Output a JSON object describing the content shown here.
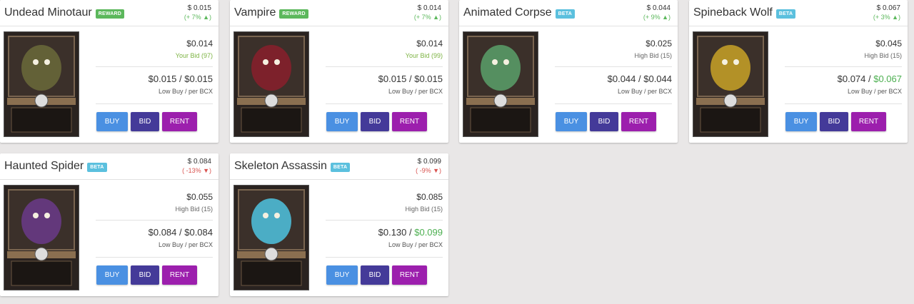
{
  "cards": [
    {
      "name": "Undead Minotaur",
      "tag": "REWARD",
      "tag_type": "reward",
      "price": "$ 0.015",
      "change": "(+ 7% ▲)",
      "change_dir": "up",
      "bid": "$0.014",
      "bid_label": "Your Bid (97)",
      "bid_label_type": "yours",
      "low_buy": "$0.015",
      "per_bcx": "$0.015",
      "per_bcx_green": false,
      "low_label": "Low Buy / per BCX",
      "art_color": "#6b6a3a"
    },
    {
      "name": "Vampire",
      "tag": "REWARD",
      "tag_type": "reward",
      "price": "$ 0.014",
      "change": "(+ 7% ▲)",
      "change_dir": "up",
      "bid": "$0.014",
      "bid_label": "Your Bid (99)",
      "bid_label_type": "yours",
      "low_buy": "$0.015",
      "per_bcx": "$0.015",
      "per_bcx_green": false,
      "low_label": "Low Buy / per BCX",
      "art_color": "#8a1f2c"
    },
    {
      "name": "Animated Corpse",
      "tag": "BETA",
      "tag_type": "beta",
      "price": "$ 0.044",
      "change": "(+ 9% ▲)",
      "change_dir": "up",
      "bid": "$0.025",
      "bid_label": "High Bid (15)",
      "bid_label_type": "high",
      "low_buy": "$0.044",
      "per_bcx": "$0.044",
      "per_bcx_green": false,
      "low_label": "Low Buy / per BCX",
      "art_color": "#5aa06a"
    },
    {
      "name": "Spineback Wolf",
      "tag": "BETA",
      "tag_type": "beta",
      "price": "$ 0.067",
      "change": "(+ 3% ▲)",
      "change_dir": "up",
      "bid": "$0.045",
      "bid_label": "High Bid (15)",
      "bid_label_type": "high",
      "low_buy": "$0.074",
      "per_bcx": "$0.067",
      "per_bcx_green": true,
      "low_label": "Low Buy / per BCX",
      "art_color": "#c9a227"
    },
    {
      "name": "Haunted Spider",
      "tag": "BETA",
      "tag_type": "beta",
      "price": "$ 0.084",
      "change": "( -13% ▼)",
      "change_dir": "down",
      "bid": "$0.055",
      "bid_label": "High Bid (15)",
      "bid_label_type": "high",
      "low_buy": "$0.084",
      "per_bcx": "$0.084",
      "per_bcx_green": false,
      "low_label": "Low Buy / per BCX",
      "art_color": "#6b3a8a"
    },
    {
      "name": "Skeleton Assassin",
      "tag": "BETA",
      "tag_type": "beta",
      "price": "$ 0.099",
      "change": "( -9% ▼)",
      "change_dir": "down",
      "bid": "$0.085",
      "bid_label": "High Bid (15)",
      "bid_label_type": "high",
      "low_buy": "$0.130",
      "per_bcx": "$0.099",
      "per_bcx_green": true,
      "low_label": "Low Buy / per BCX",
      "art_color": "#4fc3e0"
    }
  ],
  "buttons": {
    "buy": "BUY",
    "bid": "BID",
    "rent": "RENT"
  },
  "separator": " / "
}
